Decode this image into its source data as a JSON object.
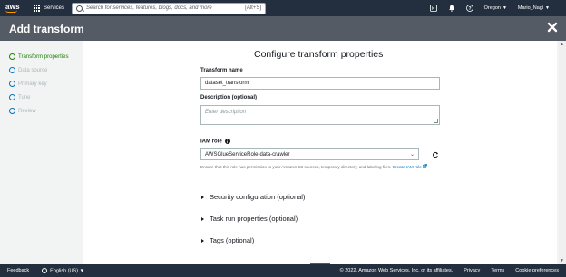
{
  "topnav": {
    "logo": "aws",
    "services_label": "Services",
    "search_placeholder": "Search for services, features, blogs, docs, and more",
    "search_shortcut": "[Alt+S]",
    "region": "Oregon",
    "user": "Mario_Nagi"
  },
  "header": {
    "title": "Add transform"
  },
  "steps": [
    {
      "label": "Transform properties",
      "state": "active"
    },
    {
      "label": "Data source",
      "state": "pending"
    },
    {
      "label": "Primary key",
      "state": "pending"
    },
    {
      "label": "Tune",
      "state": "pending"
    },
    {
      "label": "Review",
      "state": "pending"
    }
  ],
  "form": {
    "title": "Configure transform properties",
    "name_label": "Transform name",
    "name_value": "dataset_transform",
    "desc_label": "Description (optional)",
    "desc_placeholder": "Enter description",
    "iam_label": "IAM role",
    "iam_value": "AWSGlueServiceRole-data-crawler",
    "iam_help": "Ensure that this role has permission to your Amazon S3 sources, temporary directory, and labeling files.",
    "iam_help_link": "Create IAM role",
    "sections": [
      "Security configuration (optional)",
      "Task run properties (optional)",
      "Tags (optional)"
    ]
  },
  "footer": {
    "feedback": "Feedback",
    "language": "English (US)",
    "copyright": "© 2022, Amazon Web Services, Inc. or its affiliates.",
    "privacy": "Privacy",
    "terms": "Terms",
    "cookies": "Cookie preferences"
  },
  "colors": {
    "nav_bg": "#232f3e",
    "header_bg": "#545b64",
    "accent_orange": "#ff9900",
    "link_blue": "#0073bb",
    "active_green": "#1d8102"
  }
}
